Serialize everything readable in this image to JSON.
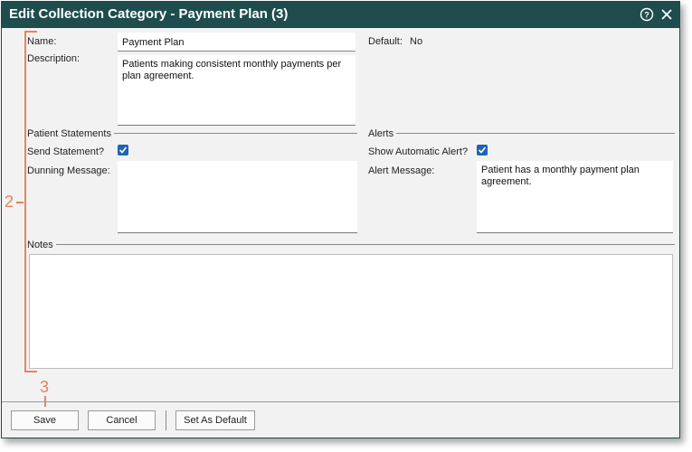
{
  "dialog": {
    "title": "Edit Collection Category - Payment Plan (3)"
  },
  "form": {
    "name_label": "Name:",
    "name_value": "Payment Plan",
    "default_label": "Default:",
    "default_value": "No",
    "description_label": "Description:",
    "description_value": "Patients making consistent monthly payments per plan agreement."
  },
  "patient_statements": {
    "section_label": "Patient Statements",
    "send_statement_label": "Send Statement?",
    "send_statement_checked": true,
    "dunning_label": "Dunning Message:",
    "dunning_value": ""
  },
  "alerts": {
    "section_label": "Alerts",
    "show_alert_label": "Show Automatic Alert?",
    "show_alert_checked": true,
    "alert_message_label": "Alert Message:",
    "alert_message_value": "Patient has a monthly payment plan agreement."
  },
  "notes": {
    "section_label": "Notes",
    "value": ""
  },
  "footer": {
    "save_label": "Save",
    "cancel_label": "Cancel",
    "set_default_label": "Set As Default"
  },
  "annotations": {
    "bracket_number": "2",
    "save_number": "3"
  },
  "colors": {
    "titlebar": "#1f4d4e",
    "checkbox": "#1e63b5",
    "annotation": "#e8835f"
  }
}
